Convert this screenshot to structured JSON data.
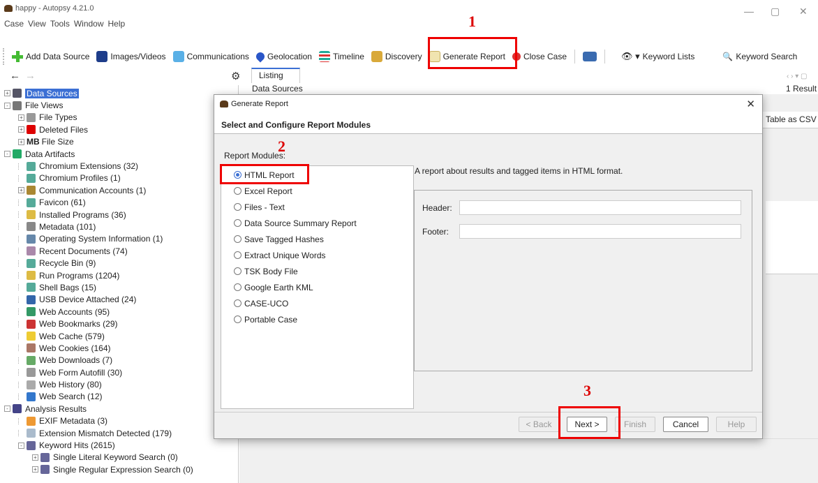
{
  "window": {
    "title": "happy - Autopsy 4.21.0",
    "min": "—",
    "restore": "▢",
    "close": "✕"
  },
  "menu": [
    "Case",
    "View",
    "Tools",
    "Window",
    "Help"
  ],
  "toolbar": {
    "add_data_source": "Add Data Source",
    "images_videos": "Images/Videos",
    "communications": "Communications",
    "geolocation": "Geolocation",
    "timeline": "Timeline",
    "discovery": "Discovery",
    "generate_report": "Generate Report",
    "close_case": "Close Case",
    "keyword_lists": "Keyword Lists",
    "keyword_search": "Keyword Search"
  },
  "listing": {
    "tab": "Listing",
    "path": "Data Sources",
    "results": "1 Result",
    "table_csv": "Table as CSV"
  },
  "tree": [
    {
      "level": 0,
      "exp": "+",
      "label": "Data Sources",
      "selected": true,
      "color": "#556"
    },
    {
      "level": 0,
      "exp": "-",
      "label": "File Views",
      "color": "#777"
    },
    {
      "level": 1,
      "exp": "+",
      "label": "File Types",
      "color": "#999"
    },
    {
      "level": 1,
      "exp": "+",
      "label": "Deleted Files",
      "color": "#d00"
    },
    {
      "level": 1,
      "exp": "+",
      "label": "File Size",
      "prefix": "MB",
      "color": ""
    },
    {
      "level": 0,
      "exp": "-",
      "label": "Data Artifacts",
      "color": "#2a6"
    },
    {
      "level": 1,
      "exp": "",
      "label": "Chromium Extensions (32)",
      "color": "#5a9"
    },
    {
      "level": 1,
      "exp": "",
      "label": "Chromium Profiles (1)",
      "color": "#5a9"
    },
    {
      "level": 1,
      "exp": "+",
      "label": "Communication Accounts (1)",
      "color": "#a83"
    },
    {
      "level": 1,
      "exp": "",
      "label": "Favicon (61)",
      "color": "#5a9"
    },
    {
      "level": 1,
      "exp": "",
      "label": "Installed Programs (36)",
      "color": "#db4"
    },
    {
      "level": 1,
      "exp": "",
      "label": "Metadata (101)",
      "color": "#888"
    },
    {
      "level": 1,
      "exp": "",
      "label": "Operating System Information (1)",
      "color": "#68a"
    },
    {
      "level": 1,
      "exp": "",
      "label": "Recent Documents (74)",
      "color": "#a8a"
    },
    {
      "level": 1,
      "exp": "",
      "label": "Recycle Bin (9)",
      "color": "#5a9"
    },
    {
      "level": 1,
      "exp": "",
      "label": "Run Programs (1204)",
      "color": "#db4"
    },
    {
      "level": 1,
      "exp": "",
      "label": "Shell Bags (15)",
      "color": "#5a9"
    },
    {
      "level": 1,
      "exp": "",
      "label": "USB Device Attached (24)",
      "color": "#36a"
    },
    {
      "level": 1,
      "exp": "",
      "label": "Web Accounts (95)",
      "color": "#396"
    },
    {
      "level": 1,
      "exp": "",
      "label": "Web Bookmarks (29)",
      "color": "#c33"
    },
    {
      "level": 1,
      "exp": "",
      "label": "Web Cache (579)",
      "color": "#ec3"
    },
    {
      "level": 1,
      "exp": "",
      "label": "Web Cookies (164)",
      "color": "#a76"
    },
    {
      "level": 1,
      "exp": "",
      "label": "Web Downloads (7)",
      "color": "#6a6"
    },
    {
      "level": 1,
      "exp": "",
      "label": "Web Form Autofill (30)",
      "color": "#999"
    },
    {
      "level": 1,
      "exp": "",
      "label": "Web History (80)",
      "color": "#aaa"
    },
    {
      "level": 1,
      "exp": "",
      "label": "Web Search (12)",
      "color": "#37c"
    },
    {
      "level": 0,
      "exp": "-",
      "label": "Analysis Results",
      "color": "#448"
    },
    {
      "level": 1,
      "exp": "",
      "label": "EXIF Metadata (3)",
      "color": "#e93"
    },
    {
      "level": 1,
      "exp": "",
      "label": "Extension Mismatch Detected (179)",
      "color": "#abc"
    },
    {
      "level": 1,
      "exp": "-",
      "label": "Keyword Hits (2615)",
      "color": "#669"
    },
    {
      "level": 2,
      "exp": "+",
      "label": "Single Literal Keyword Search (0)",
      "color": "#669"
    },
    {
      "level": 2,
      "exp": "+",
      "label": "Single Regular Expression Search (0)",
      "color": "#669"
    }
  ],
  "dialog": {
    "title": "Generate Report",
    "subtitle": "Select and Configure Report Modules",
    "modules_label": "Report Modules:",
    "modules": [
      "HTML Report",
      "Excel Report",
      "Files - Text",
      "Data Source Summary Report",
      "Save Tagged Hashes",
      "Extract Unique Words",
      "TSK Body File",
      "Google Earth KML",
      "CASE-UCO",
      "Portable Case"
    ],
    "selected_module": "HTML Report",
    "description": "A report about results and tagged items in HTML format.",
    "header_label": "Header:",
    "footer_label": "Footer:",
    "header_value": "",
    "footer_value": "",
    "buttons": {
      "back": "< Back",
      "next": "Next >",
      "finish": "Finish",
      "cancel": "Cancel",
      "help": "Help"
    }
  },
  "annotations": {
    "n1": "1",
    "n2": "2",
    "n3": "3",
    "color": "#e00000"
  }
}
